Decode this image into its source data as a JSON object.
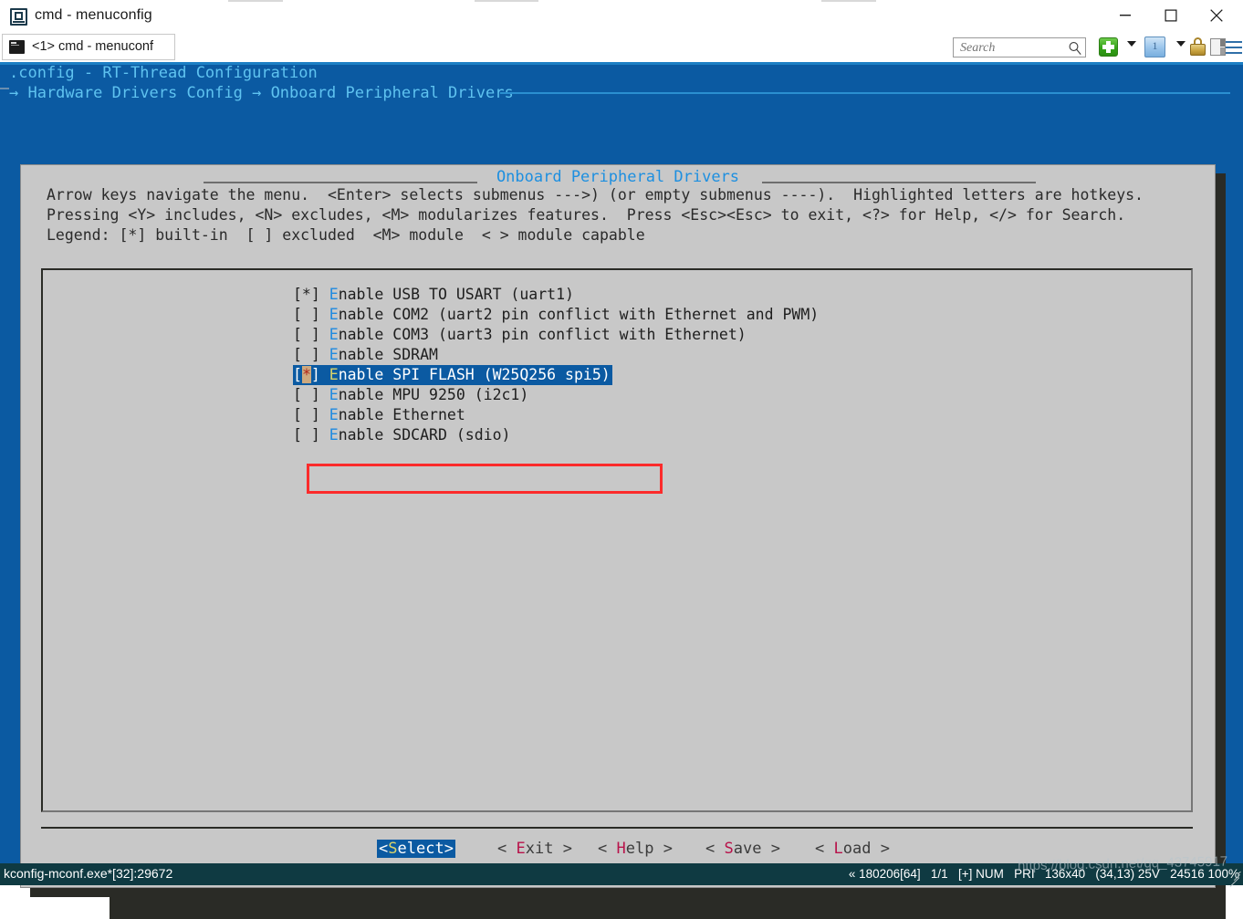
{
  "window": {
    "title": "cmd - menuconfig",
    "icon": "console-window-icon",
    "minimize_label": "minimize-icon",
    "maximize_label": "maximize-icon",
    "close_label": "close-icon"
  },
  "tabbar": {
    "tab_label": "<1> cmd - menuconf",
    "tab_icon": "terminal-icon"
  },
  "toolbar": {
    "search_placeholder": "Search",
    "search_value": "",
    "search_icon": "magnifier-icon",
    "new_tab_icon": "green-plus-icon",
    "new_tab_caret": "chevron-down-icon",
    "session_icon": "blue-one-icon",
    "session_caret": "chevron-down-icon",
    "lock_icon": "padlock-icon",
    "split_icon": "split-pane-icon",
    "menu_icon": "hamburger-menu-icon"
  },
  "console": {
    "header_line1": ".config - RT-Thread Configuration",
    "header_line2": "→ Hardware Drivers Config → Onboard Peripheral Drivers"
  },
  "dialog": {
    "title": "Onboard Peripheral Drivers",
    "help_lines": [
      "Arrow keys navigate the menu.  <Enter> selects submenus --->) (or empty submenus ----).  Highlighted letters are hotkeys.",
      "Pressing <Y> includes, <N> excludes, <M> modularizes features.  Press <Esc><Esc> to exit, <?> for Help, </> for Search.",
      "Legend: [*] built-in  [ ] excluded  <M> module  < > module capable"
    ],
    "menu_items": [
      {
        "state": "[*]",
        "hotkey": "E",
        "label": "nable USB TO USART (uart1)",
        "selected": false
      },
      {
        "state": "[ ]",
        "hotkey": "E",
        "label": "nable COM2 (uart2 pin conflict with Ethernet and PWM)",
        "selected": false
      },
      {
        "state": "[ ]",
        "hotkey": "E",
        "label": "nable COM3 (uart3 pin conflict with Ethernet)",
        "selected": false
      },
      {
        "state": "[ ]",
        "hotkey": "E",
        "label": "nable SDRAM",
        "selected": false
      },
      {
        "state": "[*]",
        "hotkey": "E",
        "label": "nable SPI FLASH (W25Q256 spi5)",
        "selected": true
      },
      {
        "state": "[ ]",
        "hotkey": "E",
        "label": "nable MPU 9250 (i2c1)",
        "selected": false
      },
      {
        "state": "[ ]",
        "hotkey": "E",
        "label": "nable Ethernet",
        "selected": false
      },
      {
        "state": "[ ]",
        "hotkey": "E",
        "label": "nable SDCARD (sdio)",
        "selected": false
      }
    ],
    "buttons": [
      {
        "name": "select",
        "open": "<",
        "key": "S",
        "rest": "elect",
        "close": ">",
        "selected": true
      },
      {
        "name": "exit",
        "open": "< ",
        "key": "E",
        "rest": "xit",
        "close": " >",
        "selected": false
      },
      {
        "name": "help",
        "open": "< ",
        "key": "H",
        "rest": "elp",
        "close": " >",
        "selected": false
      },
      {
        "name": "save",
        "open": "< ",
        "key": "S",
        "rest": "ave",
        "close": " >",
        "selected": false
      },
      {
        "name": "load",
        "open": "< ",
        "key": "L",
        "rest": "oad",
        "close": " >",
        "selected": false
      }
    ]
  },
  "statusbar": {
    "left": "kconfig-mconf.exe*[32]:29672",
    "right": "« 180206[64]   1/1   [+] NUM   PRI   136x40   (34,13) 25V   24516 100%"
  },
  "watermark": "https://blog.csdn.net/qq_43745917",
  "colors": {
    "console_blue": "#0b5aa2",
    "dialog_gray": "#c8c8c8",
    "hotkey_blue": "#1f8ae0",
    "title_blue": "#1d8fe0",
    "annotation_red": "#fb2b2b",
    "status_bg": "#0f3a42",
    "cursor_tan": "#cda97f"
  }
}
